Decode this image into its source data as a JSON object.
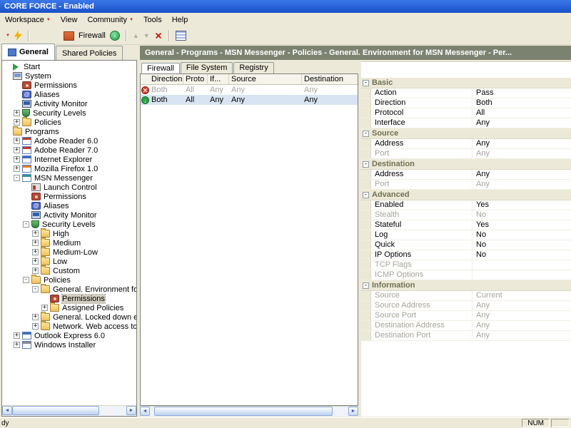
{
  "window": {
    "title": "CORE FORCE - Enabled"
  },
  "menubar": {
    "items": [
      "Workspace",
      "View",
      "Community",
      "Tools",
      "Help"
    ]
  },
  "toolbar": {
    "firewall_label": "Firewall"
  },
  "left_tabs": {
    "general": "General",
    "shared": "Shared Policies"
  },
  "breadcrumb": {
    "text": "General - Programs - MSN Messenger - Policies - General. Environment for MSN Messenger - Per..."
  },
  "tree": {
    "items": [
      {
        "label": "Start"
      },
      {
        "label": "System"
      },
      {
        "label": "Permissions"
      },
      {
        "label": "Aliases"
      },
      {
        "label": "Activity Monitor"
      },
      {
        "label": "Security Levels"
      },
      {
        "label": "Policies"
      },
      {
        "label": "Programs"
      },
      {
        "label": "Adobe Reader 6.0"
      },
      {
        "label": "Adobe Reader 7.0"
      },
      {
        "label": "Internet Explorer"
      },
      {
        "label": "Mozilla Firefox 1.0"
      },
      {
        "label": "MSN Messenger"
      },
      {
        "label": "Launch Control"
      },
      {
        "label": "Permissions"
      },
      {
        "label": "Aliases"
      },
      {
        "label": "Activity Monitor"
      },
      {
        "label": "Security Levels"
      },
      {
        "label": "High"
      },
      {
        "label": "Medium"
      },
      {
        "label": "Medium-Low"
      },
      {
        "label": "Low"
      },
      {
        "label": "Custom"
      },
      {
        "label": "Policies"
      },
      {
        "label": "General. Environment for MSN"
      },
      {
        "label": "Permissions"
      },
      {
        "label": "Assigned Policies"
      },
      {
        "label": "General. Locked down environm"
      },
      {
        "label": "Network. Web access to Messe"
      },
      {
        "label": "Outlook Express 6.0"
      },
      {
        "label": "Windows Installer"
      }
    ]
  },
  "rules": {
    "tabs": {
      "firewall": "Firewall",
      "filesystem": "File System",
      "registry": "Registry"
    },
    "columns": [
      "Direction",
      "Proto",
      "If...",
      "Source",
      "Destination"
    ],
    "rows": [
      {
        "direction": "Both",
        "proto": "All",
        "iface": "Any",
        "source": "Any",
        "destination": "Any"
      },
      {
        "direction": "Both",
        "proto": "All",
        "iface": "Any",
        "source": "Any",
        "destination": "Any"
      }
    ]
  },
  "properties": {
    "groups": [
      {
        "label": "Basic",
        "rows": [
          {
            "name": "Action",
            "value": "Pass"
          },
          {
            "name": "Direction",
            "value": "Both"
          },
          {
            "name": "Protocol",
            "value": "All"
          },
          {
            "name": "Interface",
            "value": "Any"
          }
        ]
      },
      {
        "label": "Source",
        "rows": [
          {
            "name": "Address",
            "value": "Any"
          },
          {
            "name": "Port",
            "value": "Any"
          }
        ]
      },
      {
        "label": "Destination",
        "rows": [
          {
            "name": "Address",
            "value": "Any"
          },
          {
            "name": "Port",
            "value": "Any"
          }
        ]
      },
      {
        "label": "Advanced",
        "rows": [
          {
            "name": "Enabled",
            "value": "Yes"
          },
          {
            "name": "Stealth",
            "value": "No"
          },
          {
            "name": "Stateful",
            "value": "Yes"
          },
          {
            "name": "Log",
            "value": "No"
          },
          {
            "name": "Quick",
            "value": "No"
          },
          {
            "name": "IP Options",
            "value": "No"
          },
          {
            "name": "TCP Flags",
            "value": ""
          },
          {
            "name": "ICMP Options",
            "value": ""
          }
        ]
      },
      {
        "label": "Information",
        "rows": [
          {
            "name": "Source",
            "value": "Current"
          },
          {
            "name": "Source Address",
            "value": "Any"
          },
          {
            "name": "Source Port",
            "value": "Any"
          },
          {
            "name": "Destination Address",
            "value": "Any"
          },
          {
            "name": "Destination Port",
            "value": "Any"
          }
        ]
      }
    ]
  },
  "statusbar": {
    "left": "dy",
    "num": "NUM"
  }
}
